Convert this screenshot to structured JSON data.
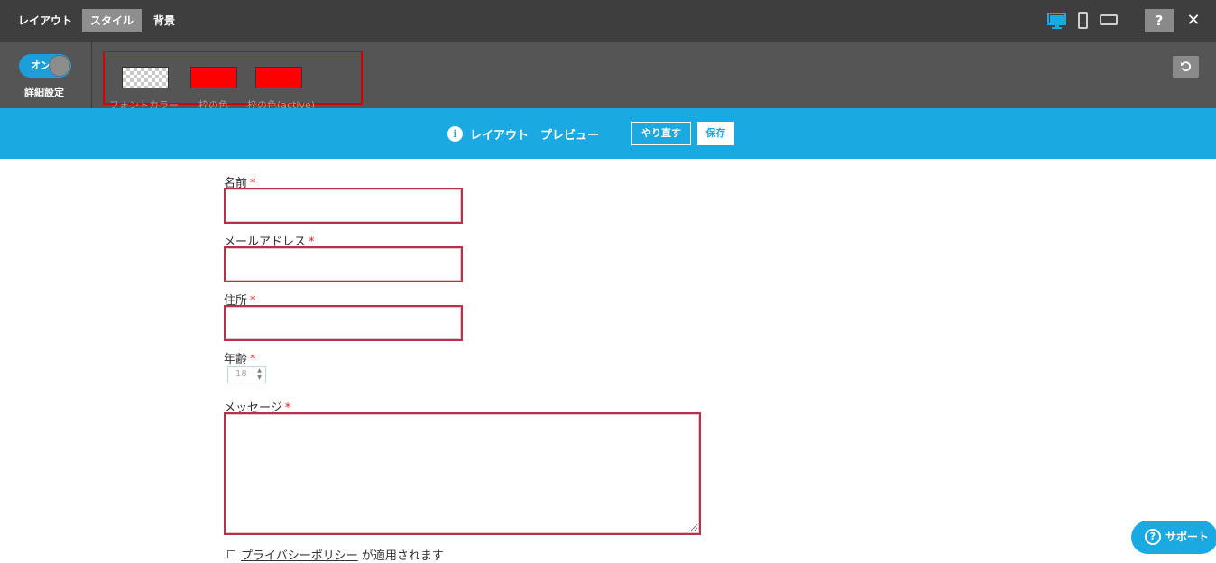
{
  "topbar": {
    "tabs": [
      {
        "label": "レイアウト",
        "active": false
      },
      {
        "label": "スタイル",
        "active": true
      },
      {
        "label": "背景",
        "active": false
      }
    ],
    "devices": [
      "desktop-icon",
      "mobile-icon",
      "tablet-icon"
    ],
    "active_device": "desktop-icon",
    "help_label": "?",
    "close_label": "✕"
  },
  "settings": {
    "toggle_label": "オン",
    "toggle_on": true,
    "advanced_label": "詳細設定",
    "swatches": [
      {
        "label": "フォントカラー",
        "color": "transparent"
      },
      {
        "label": "枠の色",
        "color": "#ff0000"
      },
      {
        "label": "枠の色(active)",
        "color": "#ff0000"
      }
    ],
    "refresh_icon": "refresh-icon"
  },
  "preview": {
    "info_icon": "i",
    "title": "レイアウト　プレビュー",
    "undo_label": "やり直す",
    "save_label": "保存"
  },
  "form": {
    "name_label": "名前",
    "email_label": "メールアドレス",
    "address_label": "住所",
    "age_label": "年齢",
    "age_value": "18",
    "message_label": "メッセージ",
    "required_mark": "*",
    "privacy_link": "プライバシーポリシー",
    "privacy_suffix": " が適用されます"
  },
  "support": {
    "label": "サポート",
    "icon": "?"
  },
  "colors": {
    "topbar_bg": "#3e3e3e",
    "settings_bg": "#555555",
    "accent": "#1ba9e1",
    "field_border": "#b8304a",
    "highlight_box": "#d40000"
  }
}
